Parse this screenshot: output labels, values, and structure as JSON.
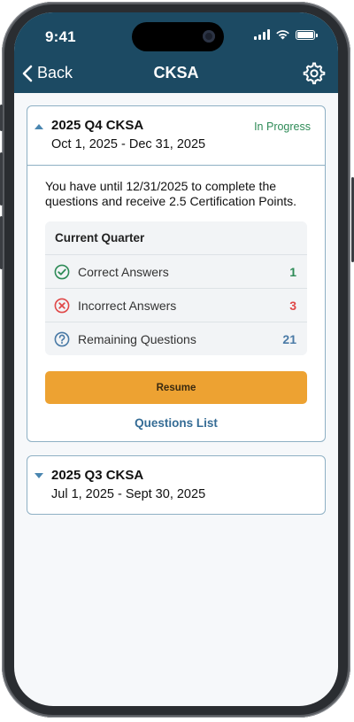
{
  "status_bar": {
    "time": "9:41"
  },
  "header": {
    "back_label": "Back",
    "title": "CKSA"
  },
  "current_card": {
    "title": "2025 Q4 CKSA",
    "dates": "Oct 1, 2025 - Dec 31, 2025",
    "status": "In Progress",
    "intro": "You have until 12/31/2025 to complete the questions and receive 2.5 Certification Points.",
    "stats_title": "Current Quarter",
    "stats": [
      {
        "label": "Correct Answers",
        "value": "1",
        "icon": "check-circle-icon",
        "color": "#2e8b57"
      },
      {
        "label": "Incorrect Answers",
        "value": "3",
        "icon": "x-circle-icon",
        "color": "#e04848"
      },
      {
        "label": "Remaining Questions",
        "value": "21",
        "icon": "question-circle-icon",
        "color": "#4a7aa6"
      }
    ],
    "resume_label": "Resume",
    "questions_list_label": "Questions List"
  },
  "previous_card": {
    "title": "2025 Q3 CKSA",
    "dates": "Jul 1, 2025 - Sept 30, 2025"
  },
  "colors": {
    "header": "#1c4a63",
    "accent": "#eda232",
    "link": "#356c95",
    "status_green": "#2e8b57"
  }
}
